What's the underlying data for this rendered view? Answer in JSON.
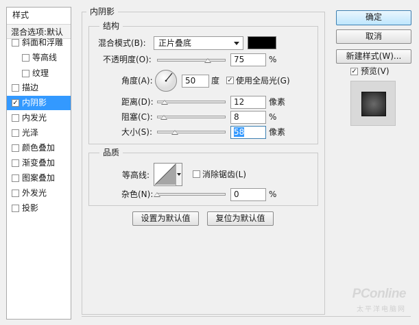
{
  "sidebar": {
    "title": "样式",
    "blend_options": "混合选项:默认",
    "items": [
      {
        "label": "斜面和浮雕",
        "checked": false,
        "indent": false,
        "selected": false
      },
      {
        "label": "等高线",
        "checked": false,
        "indent": true,
        "selected": false
      },
      {
        "label": "纹理",
        "checked": false,
        "indent": true,
        "selected": false
      },
      {
        "label": "描边",
        "checked": false,
        "indent": false,
        "selected": false
      },
      {
        "label": "内阴影",
        "checked": true,
        "indent": false,
        "selected": true
      },
      {
        "label": "内发光",
        "checked": false,
        "indent": false,
        "selected": false
      },
      {
        "label": "光泽",
        "checked": false,
        "indent": false,
        "selected": false
      },
      {
        "label": "颜色叠加",
        "checked": false,
        "indent": false,
        "selected": false
      },
      {
        "label": "渐变叠加",
        "checked": false,
        "indent": false,
        "selected": false
      },
      {
        "label": "图案叠加",
        "checked": false,
        "indent": false,
        "selected": false
      },
      {
        "label": "外发光",
        "checked": false,
        "indent": false,
        "selected": false
      },
      {
        "label": "投影",
        "checked": false,
        "indent": false,
        "selected": false
      }
    ]
  },
  "panel": {
    "title": "内阴影",
    "structure": {
      "title": "结构",
      "blend_mode_label": "混合模式(B):",
      "blend_mode_value": "正片叠底",
      "shadow_color": "#000000",
      "opacity_label": "不透明度(O):",
      "opacity_value": "75",
      "opacity_unit": "%",
      "angle_label": "角度(A):",
      "angle_value": "50",
      "angle_unit": "度",
      "global_light_label": "使用全局光(G)",
      "global_light_checked": true,
      "distance_label": "距离(D):",
      "distance_value": "12",
      "distance_unit": "像素",
      "choke_label": "阻塞(C):",
      "choke_value": "8",
      "choke_unit": "%",
      "size_label": "大小(S):",
      "size_value": "58",
      "size_unit": "像素"
    },
    "quality": {
      "title": "品质",
      "contour_label": "等高线:",
      "anti_alias_label": "消除锯齿(L)",
      "anti_alias_checked": false,
      "noise_label": "杂色(N):",
      "noise_value": "0",
      "noise_unit": "%"
    },
    "make_default_label": "设置为默认值",
    "reset_default_label": "复位为默认值"
  },
  "actions": {
    "ok_label": "确定",
    "cancel_label": "取消",
    "new_style_label": "新建样式(W)...",
    "preview_label": "预览(V)",
    "preview_checked": true
  },
  "watermark": {
    "brand": "PConline",
    "tagline": "太平洋电脑网"
  },
  "colors": {
    "selection": "#3399ff",
    "primary_button": "#bee6fd"
  }
}
